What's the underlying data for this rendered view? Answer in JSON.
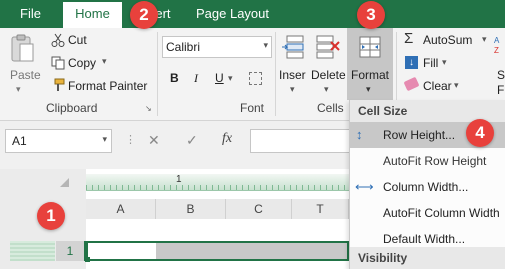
{
  "tabs": [
    "File",
    "Home",
    "Insert",
    "Page Layout"
  ],
  "clipboard": {
    "paste": "Paste",
    "cut": "Cut",
    "copy": "Copy",
    "format_painter": "Format Painter",
    "label": "Clipboard"
  },
  "font": {
    "name": "Calibri",
    "bold": "B",
    "italic": "I",
    "underline": "U",
    "label": "Font"
  },
  "cells": {
    "insert": "Inser",
    "delete": "Delete",
    "format": "Format",
    "label": "Cells"
  },
  "editing": {
    "autosum": "AutoSum",
    "fill": "Fill",
    "clear": "Clear",
    "sort_partial": "So",
    "filter_partial": "Filt"
  },
  "formula_bar": {
    "name_box": "A1",
    "fx": "fx"
  },
  "ruler_mark": "1",
  "columns": [
    "A",
    "B",
    "C",
    "T"
  ],
  "row_number": "1",
  "menu": {
    "header1": "Cell Size",
    "items": [
      "Row Height...",
      "AutoFit Row Height",
      "Column Width...",
      "AutoFit Column Width",
      "Default Width..."
    ],
    "header2": "Visibility"
  },
  "badges": [
    "1",
    "2",
    "3",
    "4"
  ],
  "colors": {
    "excel_green": "#217346",
    "badge_red": "#e8413c",
    "highlight": "#c8c8c8"
  }
}
